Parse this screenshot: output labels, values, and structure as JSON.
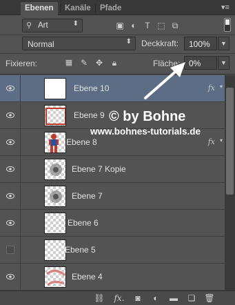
{
  "tabs": [
    {
      "label": "Ebenen",
      "active": true
    },
    {
      "label": "Kanäle",
      "active": false
    },
    {
      "label": "Pfade",
      "active": false
    }
  ],
  "panel_menu_icon": "panel-menu-icon",
  "filter": {
    "kind_label": "Art",
    "icons": [
      "pixel-filter-icon",
      "adjustment-filter-icon",
      "type-filter-icon",
      "shape-filter-icon",
      "smart-object-filter-icon"
    ]
  },
  "blend_mode": "Normal",
  "opacity": {
    "label": "Deckkraft:",
    "value": "100%"
  },
  "lock": {
    "label": "Fixieren:",
    "icons": [
      "lock-transparent-pixels-icon",
      "lock-image-pixels-icon",
      "lock-position-icon",
      "lock-all-icon"
    ]
  },
  "fill": {
    "label": "Fläche:",
    "value": "0%"
  },
  "layers": [
    {
      "name": "Ebene 10",
      "visible": true,
      "selected": true,
      "thumb": "white",
      "fx": true
    },
    {
      "name": "Ebene 9",
      "visible": true,
      "selected": false,
      "thumb": "red-outline",
      "fx": false
    },
    {
      "name": "Ebene 8",
      "visible": true,
      "selected": false,
      "thumb": "figure",
      "fx": true
    },
    {
      "name": "Ebene 7 Kopie",
      "visible": true,
      "selected": false,
      "thumb": "gray-blob",
      "fx": false
    },
    {
      "name": "Ebene 7",
      "visible": true,
      "selected": false,
      "thumb": "gray-blob",
      "fx": false
    },
    {
      "name": "Ebene 6",
      "visible": true,
      "selected": false,
      "thumb": "transparent",
      "fx": false
    },
    {
      "name": "Ebene 5",
      "visible": false,
      "selected": false,
      "thumb": "transparent",
      "fx": false
    },
    {
      "name": "Ebene 4",
      "visible": true,
      "selected": false,
      "thumb": "pink-swirl",
      "fx": false
    }
  ],
  "fx_label": "fx",
  "bottom_icons": [
    "link-layers-icon",
    "add-style-icon",
    "add-mask-icon",
    "new-adjustment-icon",
    "new-group-icon",
    "new-layer-icon",
    "delete-layer-icon"
  ],
  "bottom_fx_label": "fx.",
  "watermark": {
    "title": "© by Bohne",
    "url": "www.bohnes-tutorials.de"
  },
  "colors": {
    "panel": "#535353",
    "selected_layer": "#5e6d86",
    "tabbar": "#383838"
  }
}
